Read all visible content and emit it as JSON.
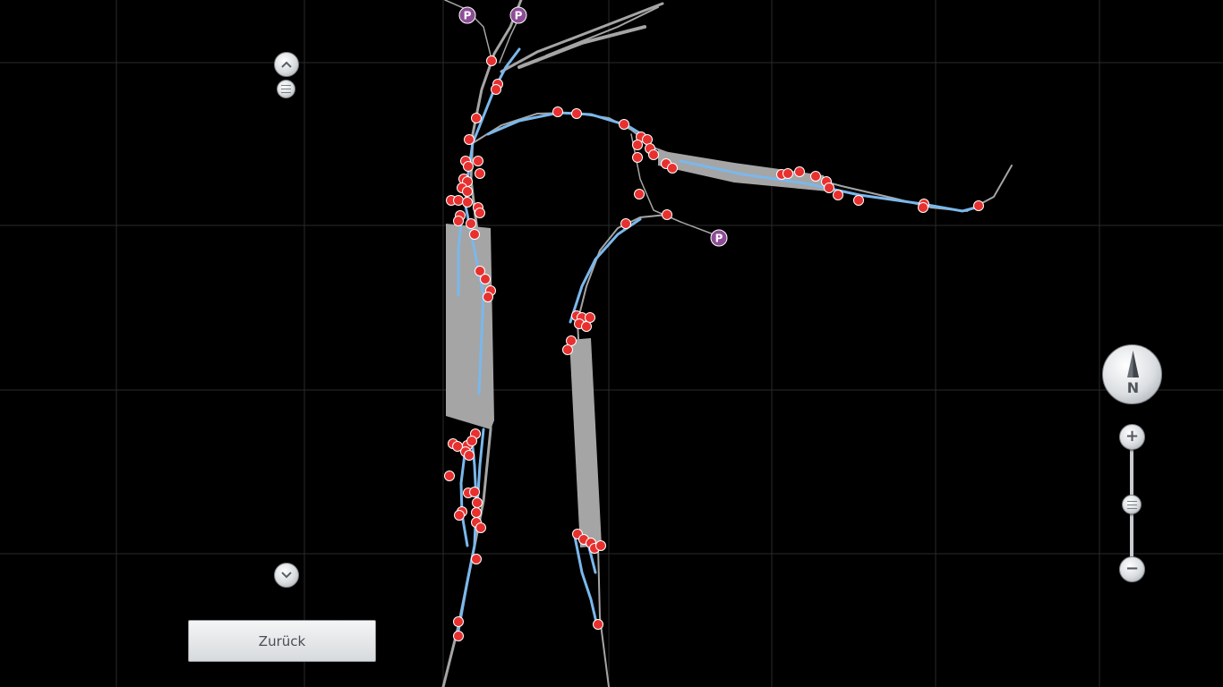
{
  "map": {
    "background": "#000000",
    "grid_color": "#2a2a2a",
    "track_color": "#a5a5a5",
    "route_color": "#7ab8ec",
    "stop_color": "#e8302f",
    "parking_color": "#8d4d96",
    "parking_label": "P"
  },
  "scroll": {
    "up_icon": "chevron-up-icon",
    "handle_icon": "drag-handle-icon",
    "down_icon": "chevron-down-icon"
  },
  "footer": {
    "back_label": "Zurück"
  },
  "compass": {
    "label": "N",
    "icon": "compass-needle-icon"
  },
  "zoom": {
    "in_icon": "plus-icon",
    "out_icon": "minus-icon",
    "level": 0.53
  }
}
